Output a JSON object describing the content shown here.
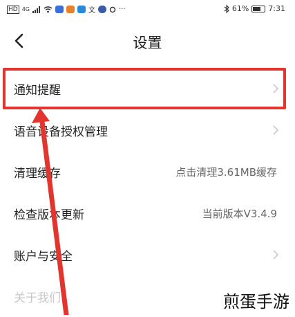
{
  "status_bar": {
    "hd_label": "HD",
    "network_label": "4G",
    "battery_text": "61%",
    "battery_level": 0.61,
    "time": "7:31"
  },
  "header": {
    "title": "设置",
    "back_icon": "back-arrow-icon"
  },
  "settings_items": [
    {
      "label": "通知提醒",
      "value": "",
      "chevron": true
    },
    {
      "label": "语音设备授权管理",
      "value": "",
      "chevron": true
    },
    {
      "label": "清理缓存",
      "value": "点击清理3.61MB缓存",
      "chevron": false
    },
    {
      "label": "检查版本更新",
      "value": "当前版本V3.4.9",
      "chevron": false
    },
    {
      "label": "账户与安全",
      "value": "",
      "chevron": true
    },
    {
      "label": "关于我们",
      "value": "",
      "chevron": false
    }
  ],
  "annotation": {
    "highlight_color": "#e1352d"
  },
  "watermark": {
    "text": "煎蛋手游"
  }
}
